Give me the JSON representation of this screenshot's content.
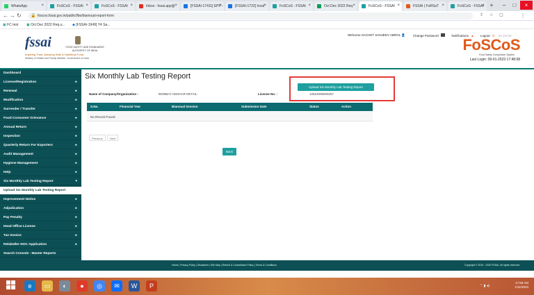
{
  "browser": {
    "tabs": [
      {
        "label": "WhatsApp",
        "color": "#25d366"
      },
      {
        "label": "FoSCoS - FSSAI",
        "color": "#1f9fa0"
      },
      {
        "label": "FoSCoS - FSSAI",
        "color": "#1f9fa0"
      },
      {
        "label": "Inbox - fssai.app@",
        "color": "#d93025"
      },
      {
        "label": "[FSSAI-17411] EPP -",
        "color": "#1a73e8"
      },
      {
        "label": "[FSSAI-1722] Inval",
        "color": "#1a73e8"
      },
      {
        "label": "FoSCoS - FSSAI",
        "color": "#1f9fa0"
      },
      {
        "label": "Oct Dec 2022 Req",
        "color": "#0f9d58"
      },
      {
        "label": "FoSCoS - FSSAI",
        "color": "#1f9fa0"
      },
      {
        "label": "FSSAI | FoRSaT",
        "color": "#e05a1a"
      },
      {
        "label": "FoSCoS - FSSAI",
        "color": "#1f9fa0"
      }
    ],
    "url": "foscos.fssai.gov.in/public/fbo/biannual-report-form",
    "bookmarks": [
      "FC test",
      "Oct Dec 2022 Req.u...",
      "[FSSAI-1949] Y4 Sa..."
    ]
  },
  "header": {
    "logo_text": "fssai",
    "tagline": "Inspiring Trust, Assuring Safe & Nutritious Food",
    "tagline2": "Ministry of Health and Family Welfare, Government of India",
    "authority": "FOOD SAFETY AND STANDARDS AUTHORITY OF INDIA",
    "welcome": "Welcome SACHET SANJEEV ABROL",
    "change_password": "Change Password",
    "notifications": "Notifications",
    "logout": "Logout",
    "brand": "FoSCoS",
    "brand_sub": "Food Safety Compliance System",
    "last_login": "Last Login: 09-01-2023 17:48:08"
  },
  "sidebar": {
    "items": [
      {
        "label": "Dashboard",
        "arrow": ""
      },
      {
        "label": "License/Registration",
        "arrow": "▸"
      },
      {
        "label": "Renewal",
        "arrow": "▸"
      },
      {
        "label": "Modification",
        "arrow": "▸"
      },
      {
        "label": "Surrender / Transfer",
        "arrow": "▸"
      },
      {
        "label": "Food Consumer Grievance",
        "arrow": "▸"
      },
      {
        "label": "Annual Return",
        "arrow": "▸"
      },
      {
        "label": "Inspection",
        "arrow": "▸"
      },
      {
        "label": "Quarterly Return For Exporters",
        "arrow": "▸"
      },
      {
        "label": "Audit Management",
        "arrow": "▸"
      },
      {
        "label": "Hygiene Management",
        "arrow": "▸"
      },
      {
        "label": "Help",
        "arrow": "▸"
      },
      {
        "label": "Six Monthly Lab Testing Report",
        "arrow": "▾"
      },
      {
        "label": "Upload Six Monthly Lab Testing Report",
        "arrow": ""
      },
      {
        "label": "Improvement Notice",
        "arrow": "▸"
      },
      {
        "label": "Adjudication",
        "arrow": "▸"
      },
      {
        "label": "Pay Penalty",
        "arrow": "▸"
      },
      {
        "label": "Head Office License",
        "arrow": "▸"
      },
      {
        "label": "Tax Invoice",
        "arrow": "▸"
      },
      {
        "label": "Relabeller NOC Application",
        "arrow": "▸"
      },
      {
        "label": "Search Console - Master Reports",
        "arrow": ""
      }
    ]
  },
  "main": {
    "title": "Six Monthly Lab Testing Report",
    "upload_button": "Upload Six Monthly Lab Testing Report",
    "company_label": "Name of Company/Organization :",
    "company_value": "BOMBAY KEDHAR RETAIL",
    "license_label": "License No. :",
    "license_value": "12522006000257",
    "table_headers": [
      "S.No.",
      "Financial Year",
      "Biannual Session",
      "Submission Date",
      "Status",
      "Action"
    ],
    "empty_message": "No Record Found",
    "pager_prev": "Previous",
    "pager_next": "Next",
    "back_button": "Back"
  },
  "footer": {
    "links": "Home | Privacy Policy | Disclaimer | Site Map | Refund & Cancellation Policy | Terms & Conditions",
    "copyright": "Copyright © 2019 - 2020 FSSAI. All rights reserved."
  },
  "taskbar": {
    "time": "17:58 AM",
    "date": "1/11/2023"
  }
}
